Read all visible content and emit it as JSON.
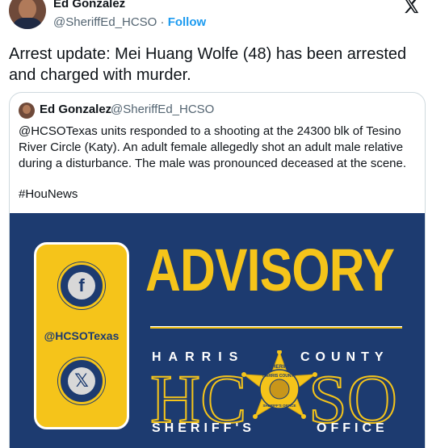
{
  "author": {
    "name": "Ed Gonzalez",
    "handle": "@SheriffEd_HCSO",
    "separator": " · ",
    "follow_label": "Follow"
  },
  "tweet": {
    "text": "Arrest update: Mei Huang Wolfe (48) has been arrested and charged with murder."
  },
  "quoted": {
    "name": "Ed Gonzalez",
    "handle": "@SheriffEd_HCSO",
    "text": "@HCSOTexas units responded to a shooting at the 24300 blk of Tesino River Circle (Katy). An adult female allegedly shot an adult male relative during a disturbance. The male was pronounced deceased at the scene.",
    "hashtag": "#HouNews"
  },
  "image": {
    "title": "ADVISORY",
    "social_handle": "@HCSOTexas",
    "facebook_glyph": "f",
    "x_glyph": "𝕏",
    "harris": "HARRIS",
    "county": "COUNTY",
    "hcso_h": "HC",
    "hcso_so": "SO",
    "sheriffs": "SHERIFF'S",
    "office": "OFFICE",
    "badge_top": "SHERIFF",
    "badge_arc": "HARRIS COUNTY",
    "badge_bottom": "SHERIFF'S OFFICE",
    "colors": {
      "navy": "#1d3b70",
      "gold": "#f5c41a"
    }
  },
  "icons": {
    "close": "x-logo-icon"
  }
}
